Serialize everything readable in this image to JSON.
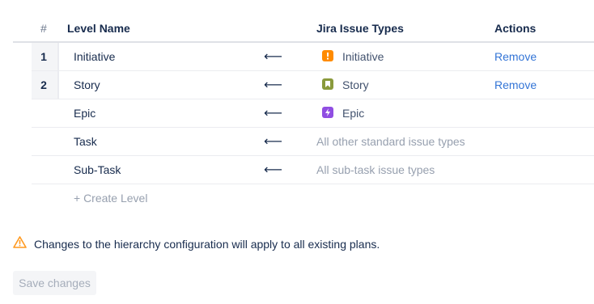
{
  "table": {
    "headers": {
      "number": "#",
      "level_name": "Level Name",
      "issue_types": "Jira Issue Types",
      "actions": "Actions"
    },
    "rows": [
      {
        "number": "1",
        "level_name": "Initiative",
        "arrow": "⟵",
        "issue_type": "Initiative",
        "issue_type_icon": "initiative-icon",
        "icon_color": "#ff8b00",
        "action": "Remove"
      },
      {
        "number": "2",
        "level_name": "Story",
        "arrow": "⟵",
        "issue_type": "Story",
        "issue_type_icon": "story-icon",
        "icon_color": "#8a9a3c",
        "action": "Remove"
      },
      {
        "number": "",
        "level_name": "Epic",
        "arrow": "⟵",
        "issue_type": "Epic",
        "issue_type_icon": "epic-icon",
        "icon_color": "#904ee2",
        "action": ""
      },
      {
        "number": "",
        "level_name": "Task",
        "arrow": "⟵",
        "issue_type": "All other standard issue types",
        "action": ""
      },
      {
        "number": "",
        "level_name": "Sub-Task",
        "arrow": "⟵",
        "issue_type": "All sub-task issue types",
        "action": ""
      }
    ],
    "create_level": "+ Create Level"
  },
  "warning": {
    "icon": "warning-icon",
    "text": "Changes to the hierarchy configuration will apply to all existing plans.",
    "color": "#ff991f"
  },
  "save_button": {
    "label": "Save changes"
  }
}
